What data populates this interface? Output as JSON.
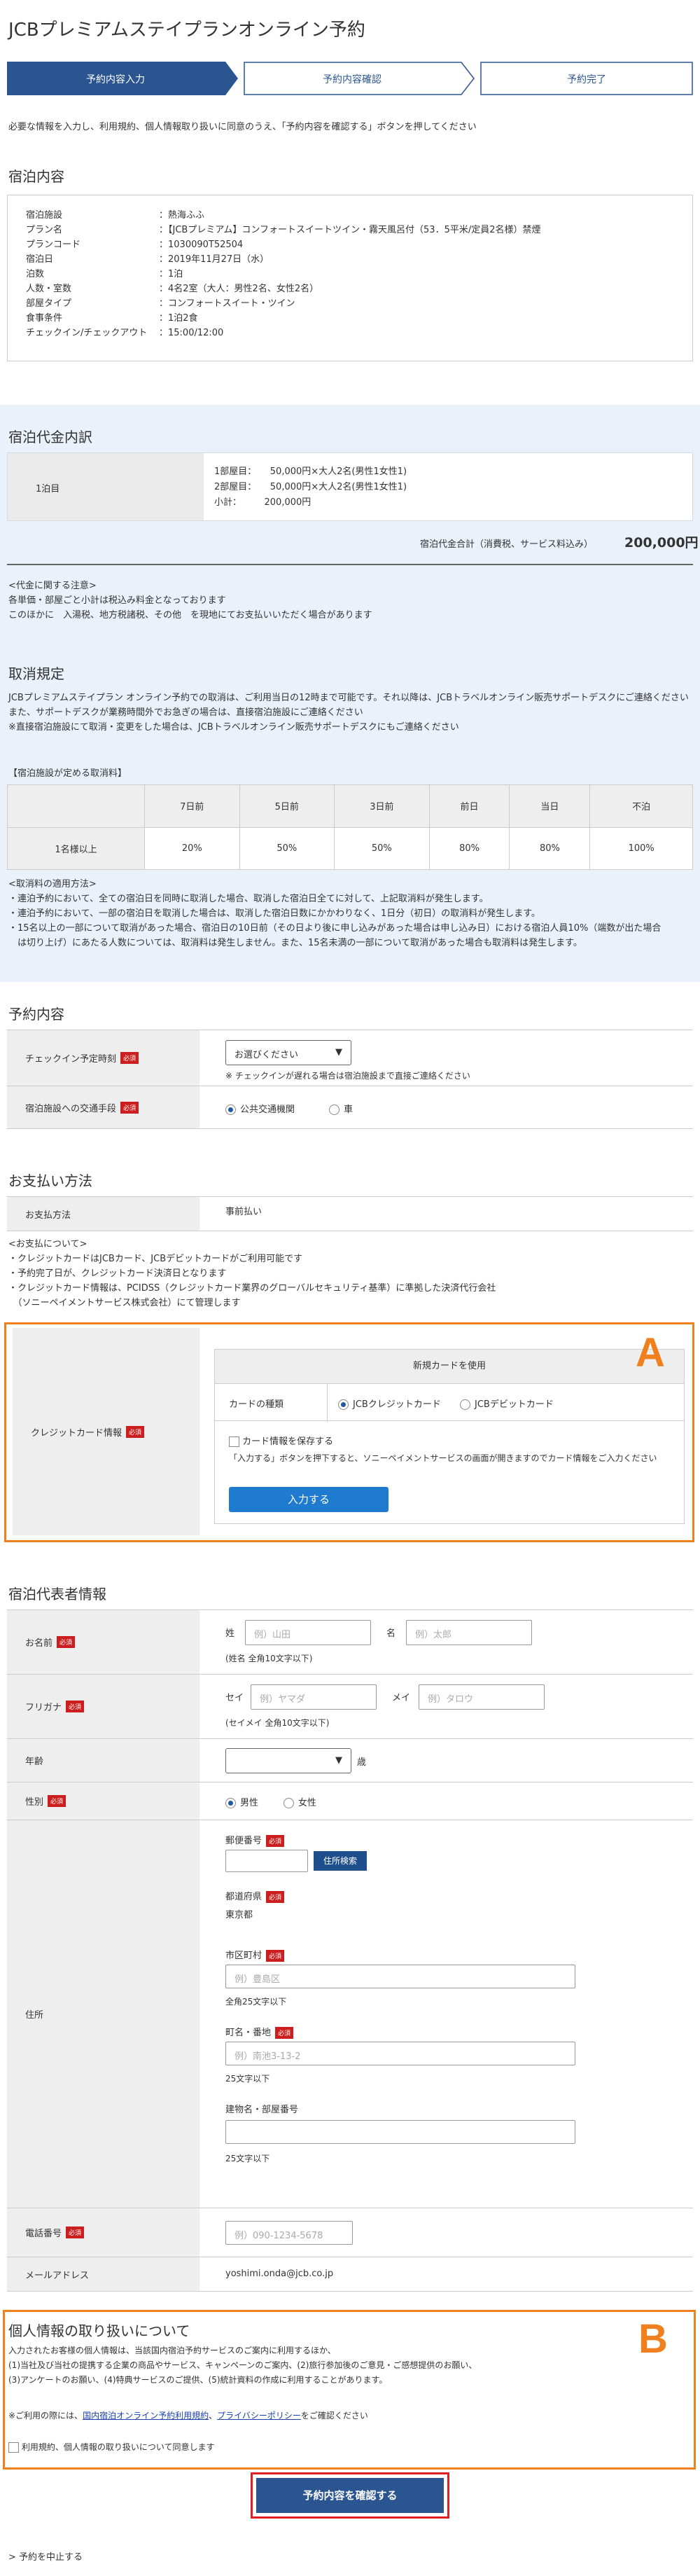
{
  "page_title": "JCBプレミアムステイプランオンライン予約",
  "steps": [
    "予約内容入力",
    "予約内容確認",
    "予約完了"
  ],
  "instruction": "必要な情報を入力し、利用規約、個人情報取り扱いに同意のうえ、「予約内容を確認する」ボタンを押してください",
  "stay": {
    "title": "宿泊内容",
    "rows": [
      [
        "宿泊施設",
        "：熱海ふふ"
      ],
      [
        "プラン名",
        "：【JCBプレミアム】コンフォートスイートツイン・霧天風呂付（53．5平米/定員2名様）禁煙"
      ],
      [
        "プランコード",
        "：1030090T52504"
      ],
      [
        "宿泊日",
        "：2019年11月27日（水）"
      ],
      [
        "泊数",
        "：1泊"
      ],
      [
        "人数・室数",
        "：4名2室（大人：男性2名、女性2名）"
      ],
      [
        "部屋タイプ",
        "：コンフォートスイート・ツイン"
      ],
      [
        "食事条件",
        "：1泊2食"
      ],
      [
        "チェックイン/チェックアウト",
        "：15:00/12:00"
      ]
    ]
  },
  "fee": {
    "title": "宿泊代金内訳",
    "night": "1泊目",
    "lines": [
      "1部屋目：　　50,000円×大人2名(男性1女性1)",
      "2部屋目：　　50,000円×大人2名(男性1女性1)",
      "小計：　　　200,000円"
    ],
    "total_label": "宿泊代金合計（消費税、サービス料込み）",
    "total_value": "200,000円",
    "notes": [
      "<代金に関する注意>",
      "各単価・部屋ごと小計は税込み料金となっております",
      "このほかに　入湯税、地方税諸税、その他　を現地にてお支払いいただく場合があります"
    ]
  },
  "cancel": {
    "title": "取消規定",
    "text": [
      "JCBプレミアムステイプラン オンライン予約での取消は、ご利用当日の12時まで可能です。それ以降は、JCBトラベルオンライン販売サポートデスクにご連絡ください",
      "また、サポートデスクが業務時間外でお急ぎの場合は、直接宿泊施設にご連絡ください",
      "※直接宿泊施設にて取消・変更をした場合は、JCBトラベルオンライン販売サポートデスクにもご連絡ください"
    ],
    "table_title": "【宿泊施設が定める取消料】",
    "headers": [
      "",
      "7日前",
      "5日前",
      "3日前",
      "前日",
      "当日",
      "不泊"
    ],
    "row": [
      "1名様以上",
      "20%",
      "50%",
      "50%",
      "80%",
      "80%",
      "100%"
    ],
    "rules": [
      "<取消料の適用方法>",
      "・連泊予約において、全ての宿泊日を同時に取消した場合、取消した宿泊日全てに対して、上記取消料が発生します。",
      "・連泊予約において、一部の宿泊日を取消した場合は、取消した宿泊日数にかかわりなく、1日分（初日）の取消料が発生します。",
      "・15名以上の一部について取消があった場合、宿泊日の10日前（その日より後に申し込みがあった場合は申し込み日）における宿泊人員10%（端数が出た場合",
      "　は切り上げ）にあたる人数については、取消料は発生しません。また、15名未満の一部について取消があった場合も取消料は発生します。"
    ]
  },
  "reservation": {
    "title": "予約内容",
    "checkin_label": "チェックイン予定時刻",
    "checkin_value": "お選びください",
    "checkin_note": "※ チェックインが遅れる場合は宿泊施設まで直接ご連絡ください",
    "transport_label": "宿泊施設への交通手段",
    "transport_options": [
      "公共交通機関",
      "車"
    ]
  },
  "payment": {
    "title": "お支払い方法",
    "method_label": "お支払方法",
    "method_value": "事前払い",
    "notes": [
      "<お支払について>",
      "・クレジットカードはJCBカード、JCBデビットカードがご利用可能です",
      "・予約完了日が、クレジットカード決済日となります",
      "・クレジットカード情報は、PCIDSS（クレジットカード業界のグローバルセキュリティ基準）に準拠した決済代行会社",
      "　（ソニーペイメントサービス株式会社）にて管理します"
    ],
    "card_label": "クレジットカード情報",
    "new_card": "新規カードを使用",
    "card_type_label": "カードの種類",
    "card_options": [
      "JCBクレジットカード",
      "JCBデビットカード"
    ],
    "save_card": "カード情報を保存する",
    "card_info": "「入力する」ボタンを押下すると、ソニーペイメントサービスの画面が開きますのでカード情報をご入力ください",
    "input_button": "入力する"
  },
  "guest": {
    "title": "宿泊代表者情報",
    "name_label": "お名前",
    "sei": "姓",
    "mei": "名",
    "sei_ph": "例）山田",
    "mei_ph": "例）太郎",
    "name_note": "(姓名 全角10文字以下)",
    "kana_label": "フリガナ",
    "sei_k": "セイ",
    "mei_k": "メイ",
    "sei_k_ph": "例）ヤマダ",
    "mei_k_ph": "例）タロウ",
    "kana_note": "(セイメイ 全角10文字以下)",
    "age_label": "年齢",
    "age_unit": "歳",
    "gender_label": "性別",
    "genders": [
      "男性",
      "女性"
    ],
    "address_label": "住所",
    "zip_label": "郵便番号",
    "zip_button": "住所検索",
    "pref_label": "都道府県",
    "pref_value": "東京都",
    "city_label": "市区町村",
    "city_ph": "例）豊島区",
    "city_note": "全角25文字以下",
    "street_label": "町名・番地",
    "street_ph": "例）南池3-13-2",
    "street_note": "25文字以下",
    "building_label": "建物名・部屋番号",
    "building_note": "25文字以下",
    "phone_label": "電話番号",
    "phone_ph": "例）090-1234-5678",
    "mail_label": "メールアドレス",
    "mail_value": "yoshimi.onda@jcb.co.jp"
  },
  "privacy": {
    "title": "個人情報の取り扱いについて",
    "text": [
      "入力されたお客様の個人情報は、当該国内宿泊予約サービスのご案内に利用するほか、",
      "(1)当社及び当社の提携する企業の商品やサービス、キャンペーンのご案内、(2)旅行参加後のご意見・ご感想提供のお願い、",
      "(3)アンケートのお願い、(4)特典サービスのご提供、(5)統計資料の作成に利用することがあります。"
    ],
    "link_prefix": "※ご利用の際には、",
    "link1": "国内宿泊オンライン予約利用規約",
    "sep": "、",
    "link2": "プライバシーポリシー",
    "link_suffix": "をご確認ください",
    "agree": "利用規約、個人情報の取り扱いについて同意します"
  },
  "confirm_button": "予約内容を確認する",
  "cancel_link": "予約を中止する",
  "annotations": [
    "A",
    "B"
  ]
}
